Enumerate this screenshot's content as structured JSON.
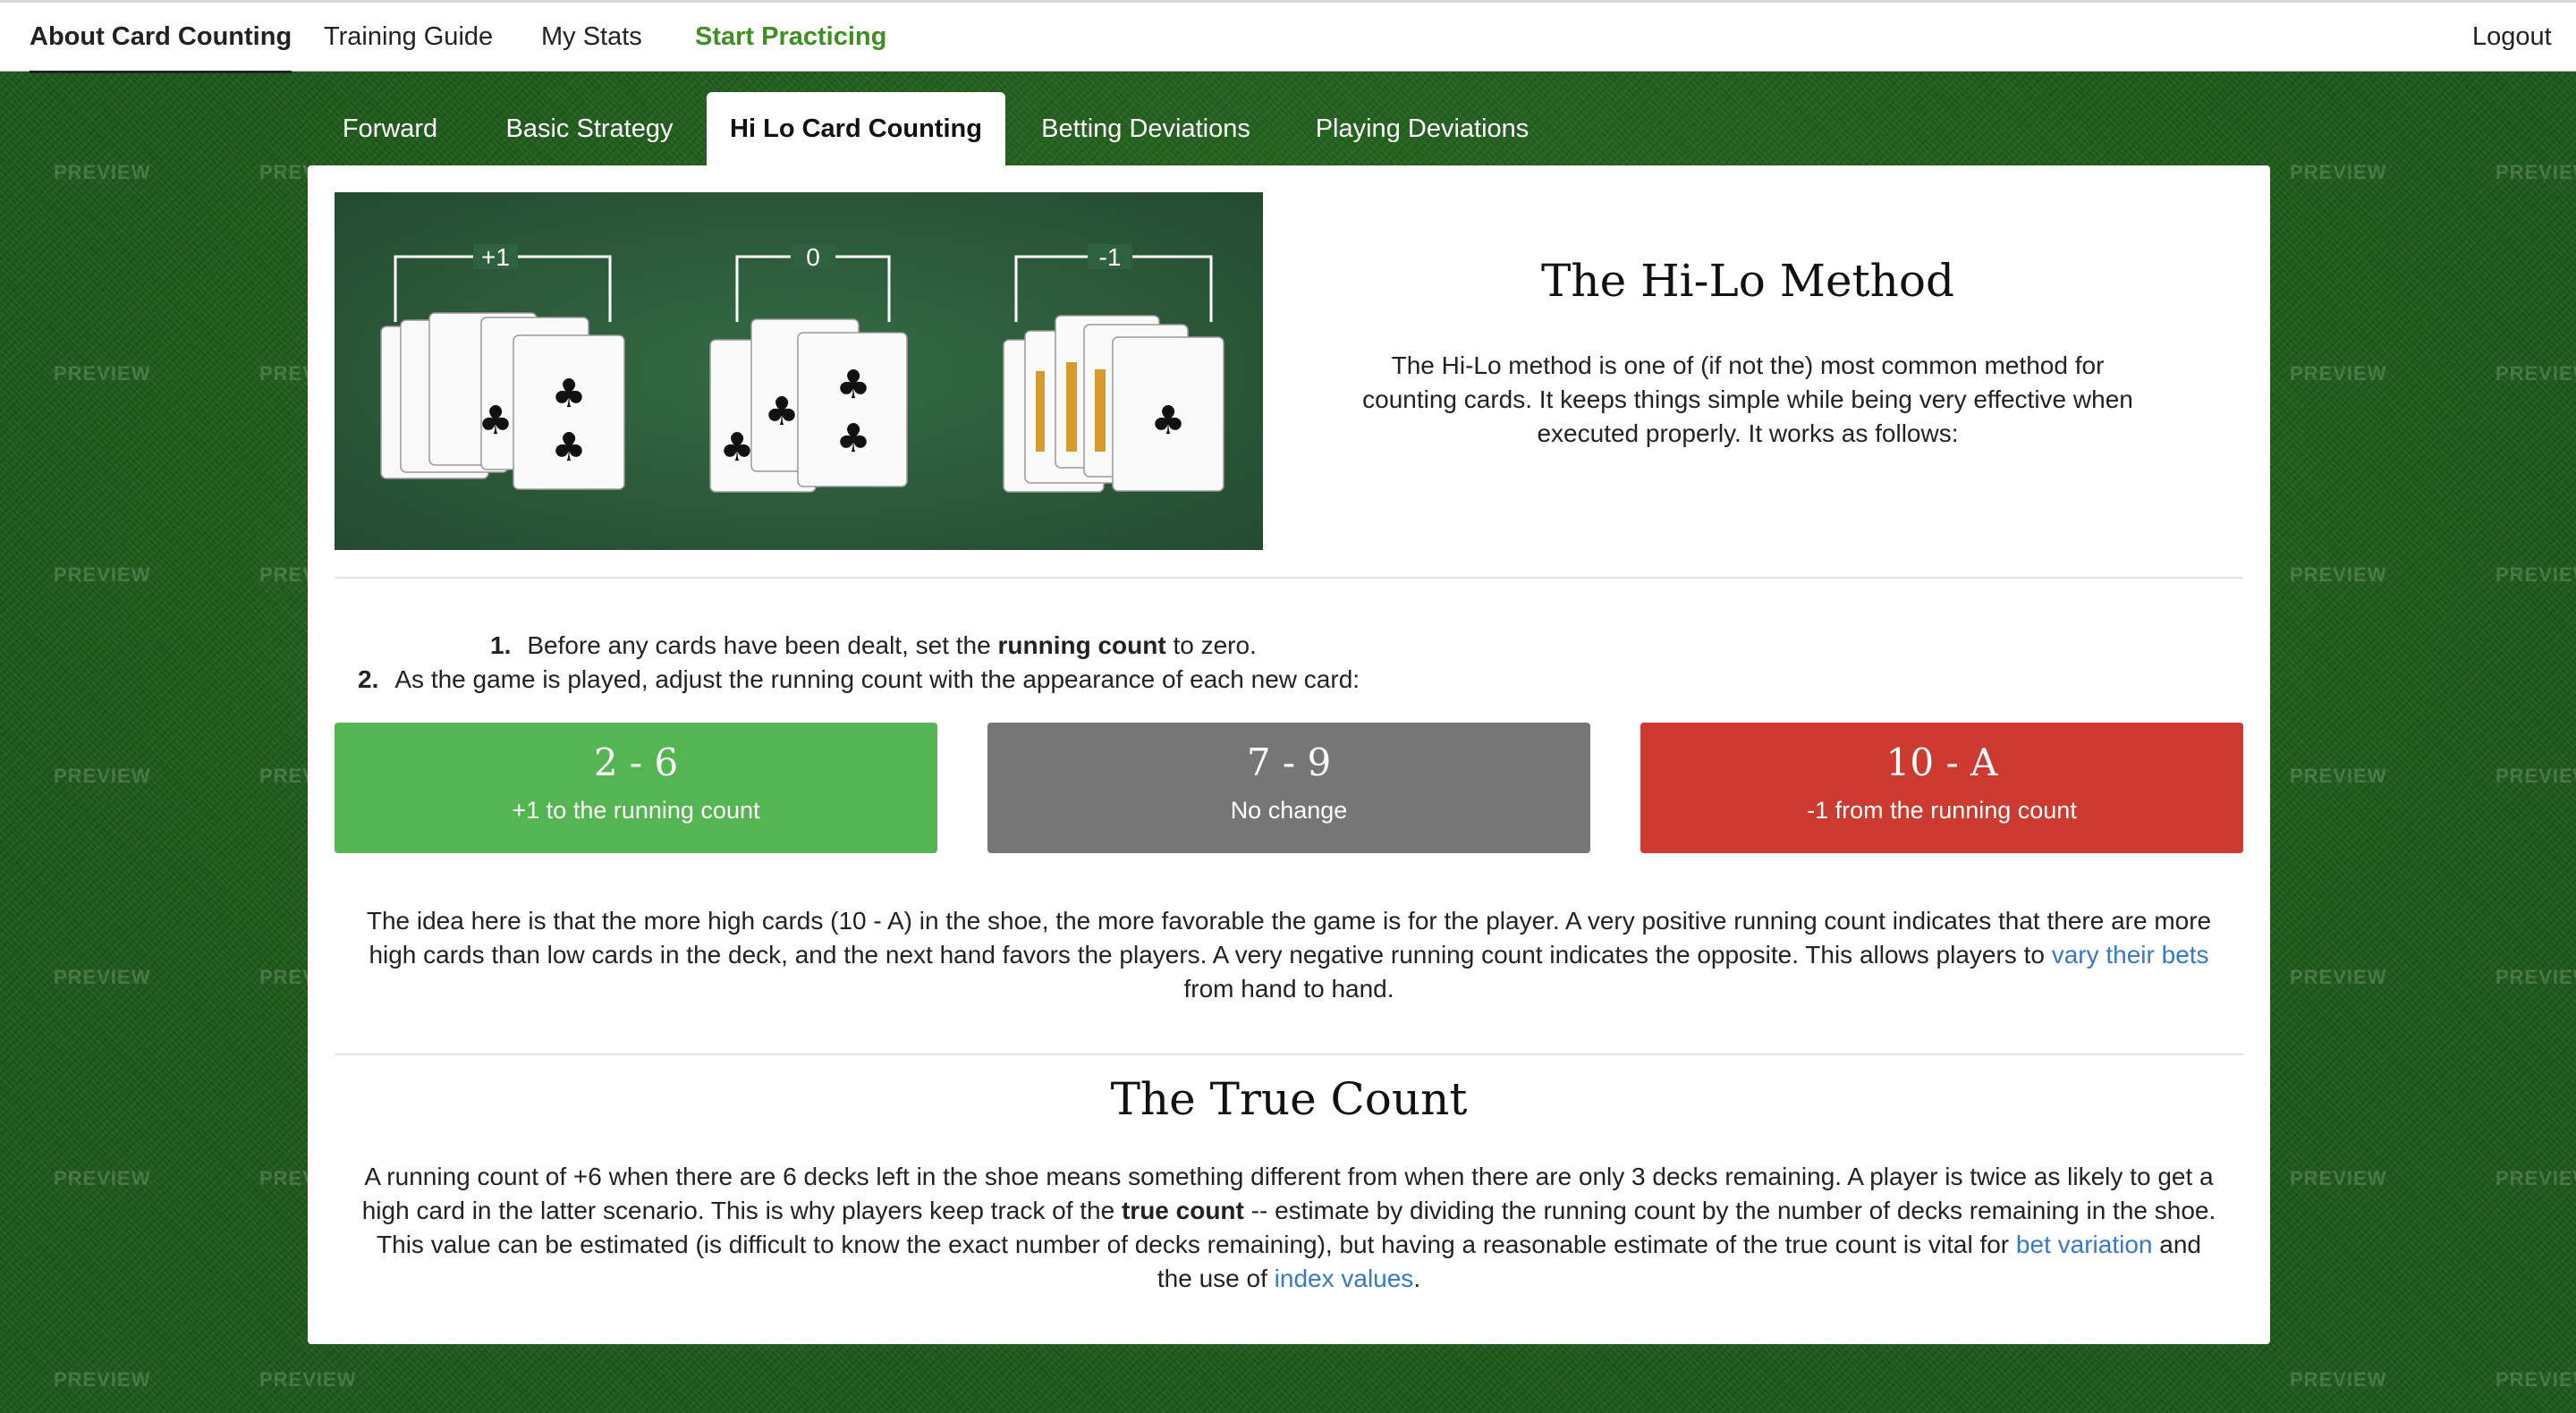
{
  "nav": {
    "about": "About Card Counting",
    "training": "Training Guide",
    "stats": "My Stats",
    "practice": "Start Practicing",
    "logout": "Logout"
  },
  "tabs": [
    "Forward",
    "Basic Strategy",
    "Hi Lo Card Counting",
    "Betting Deviations",
    "Playing Deviations"
  ],
  "watermark": "PREVIEW",
  "hero": {
    "labels": [
      "+1",
      "0",
      "-1"
    ]
  },
  "hilo": {
    "title": "The Hi-Lo Method",
    "intro": "The Hi-Lo method is one of (if not the) most common method for counting cards. It keeps things simple while being very effective when executed properly. It works as follows:"
  },
  "steps": [
    {
      "num": "1.",
      "pre": "Before any cards have been dealt, set the ",
      "bold": "running count",
      "post": " to zero."
    },
    {
      "num": "2.",
      "text": "As the game is played, adjust the running count with the appearance of each new card:"
    }
  ],
  "boxes": [
    {
      "range": "2 - 6",
      "desc": "+1 to the running count",
      "color": "#55b552"
    },
    {
      "range": "7 - 9",
      "desc": "No change",
      "color": "#767676"
    },
    {
      "range": "10 - A",
      "desc": "-1 from the running count",
      "color": "#cc3a30"
    }
  ],
  "idea": {
    "text": "The idea here is that the more high cards (10 - A) in the shoe, the more favorable the game is for the player. A very positive running count indicates that there are more high cards than low cards in the deck, and the next hand favors the players. A very negative running count indicates the opposite. This allows players to ",
    "link": "vary their bets",
    "post": " from hand to hand."
  },
  "truecount": {
    "title": "The True Count",
    "p1": "A running count of +6 when there are 6 decks left in the shoe means something different from when there are only 3 decks remaining. A player is twice as likely to get a high card in the latter scenario. This is why players keep track of the ",
    "bold": "true count",
    "p2": " -- estimate by dividing the running count by the number of decks remaining in the shoe. This value can be estimated (is difficult to know the exact number of decks remaining), but having a reasonable estimate of the true count is vital for ",
    "link1": "bet variation",
    "mid": " and the use of ",
    "link2": "index values",
    "end": "."
  }
}
